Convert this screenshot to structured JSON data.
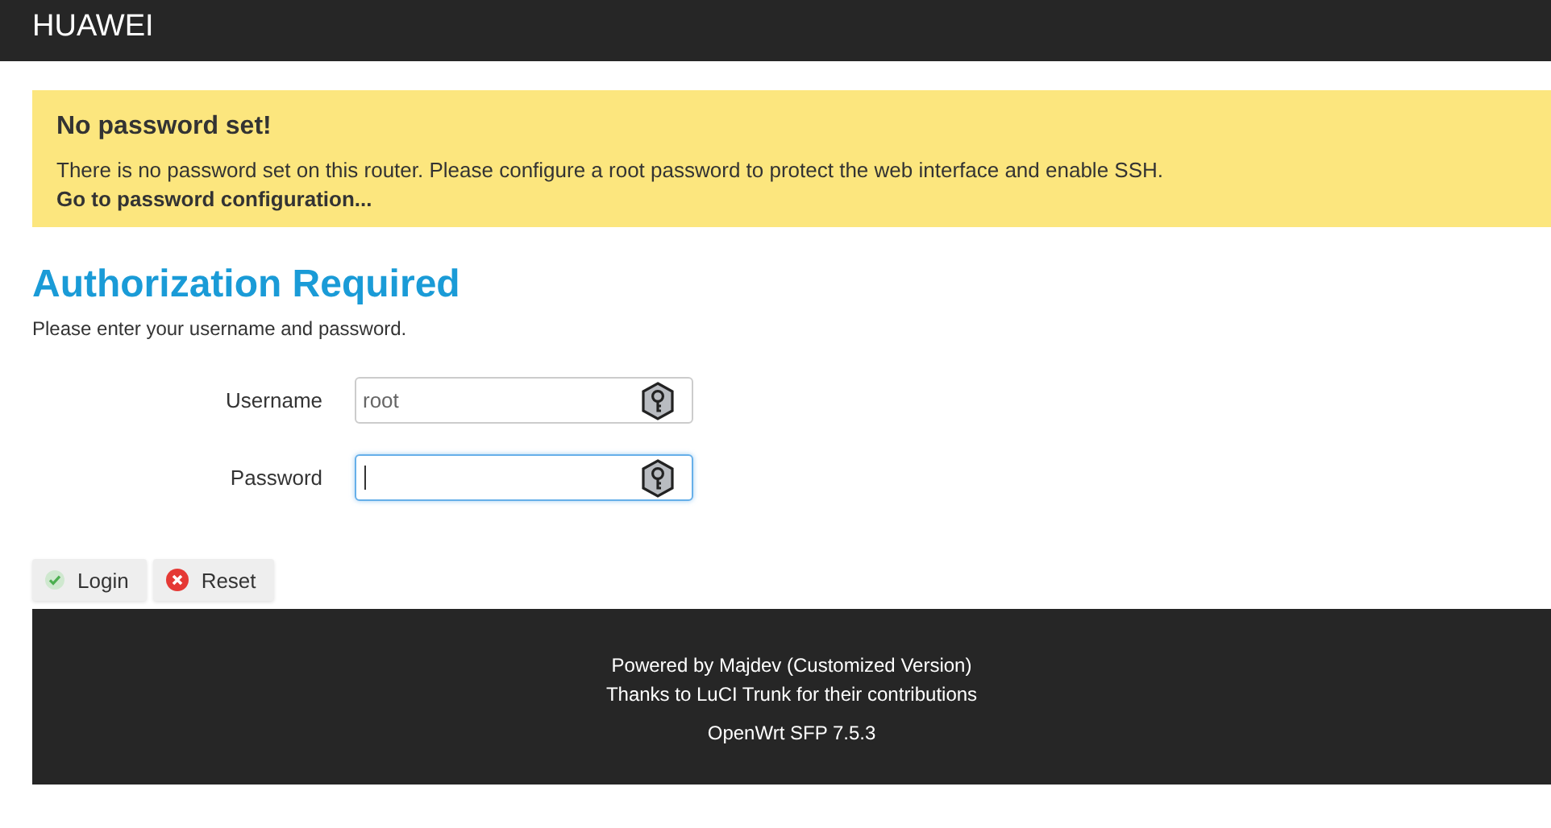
{
  "header": {
    "brand": "HUAWEI"
  },
  "alert": {
    "title": "No password set!",
    "message": "There is no password set on this router. Please configure a root password to protect the web interface and enable SSH.",
    "link": "Go to password configuration..."
  },
  "login": {
    "title": "Authorization Required",
    "subtitle": "Please enter your username and password.",
    "fields": [
      {
        "label": "Username",
        "value": "root",
        "focused": false
      },
      {
        "label": "Password",
        "focused": true
      }
    ],
    "buttons": [
      {
        "kind": "apply",
        "label": "Login"
      },
      {
        "kind": "reset",
        "label": "Reset"
      }
    ]
  },
  "footer": {
    "lines": [
      "Powered by Majdev (Customized Version)",
      "Thanks to LuCI Trunk for their contributions",
      "OpenWrt SFP 7.5.3"
    ]
  }
}
